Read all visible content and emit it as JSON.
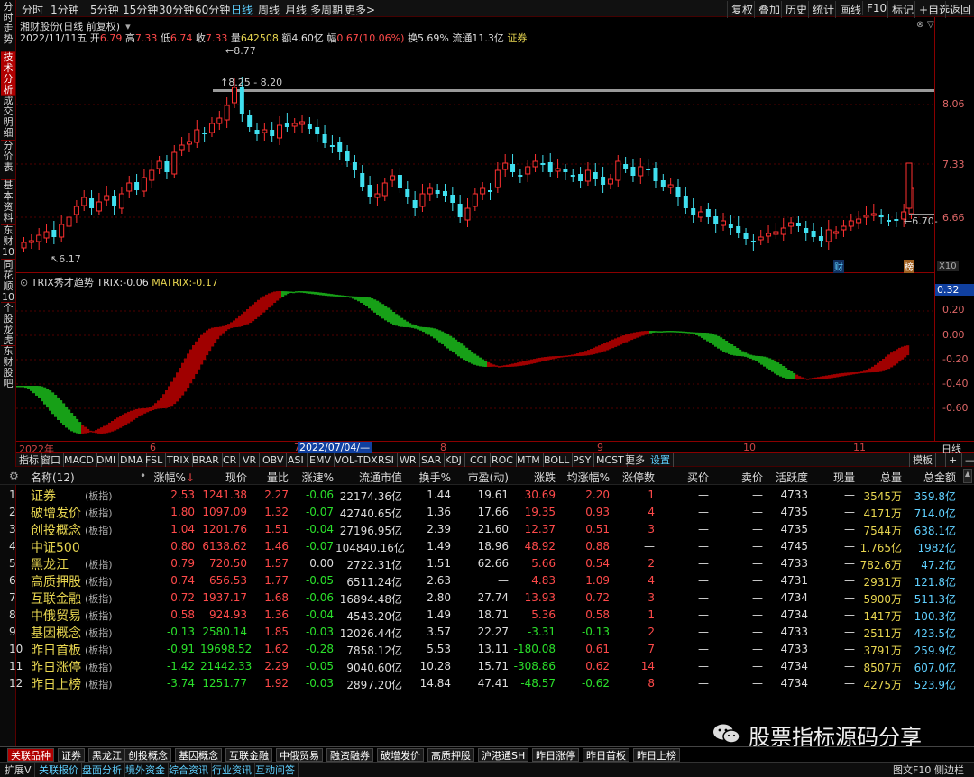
{
  "left_tabs": [
    "分时走势",
    "技术分析",
    "成交明细",
    "分价表",
    "基本资料",
    "东财10",
    "同花顺10",
    "个股龙虎",
    "东财股吧"
  ],
  "toolbar": {
    "periods": [
      "分时",
      "1分钟",
      "5分钟",
      "15分钟",
      "30分钟",
      "60分钟",
      "日线",
      "周线",
      "月线",
      "多周期",
      "更多>"
    ],
    "active_period": "日线",
    "right_buttons": [
      "复权",
      "叠加",
      "历史",
      "统计",
      "画线",
      "F10",
      "标记",
      "+自选",
      "返回"
    ]
  },
  "info": {
    "stock_title": "湘财股份(日线 前复权)",
    "date": "2022/11/11五",
    "open_label": "开",
    "open": "6.79",
    "high_label": "高",
    "high": "7.33",
    "low_label": "低",
    "low": "6.74",
    "close_label": "收",
    "close": "7.33",
    "volume_label": "量",
    "volume": "642508",
    "amount_label": "额",
    "amount": "4.60亿",
    "change_label": "幅",
    "change": "0.67(10.06%)",
    "turnover_label": "换",
    "turnover": "5.69%",
    "float_label": "流通",
    "float": "11.3亿",
    "sector": "证券"
  },
  "main_chart": {
    "price_labels": [
      "8.06",
      "7.33",
      "6.66"
    ],
    "annotations": {
      "high": "8.77",
      "range": "8.25 - 8.20",
      "low": "6.17",
      "last": "6.70"
    },
    "markers": {
      "finance": "财",
      "rank": "榜",
      "zoom": "X10"
    }
  },
  "sub_chart": {
    "title": "TRIX秀才趋势",
    "trix_label": "TRIX:",
    "trix": "-0.06",
    "matrix_label": "MATRIX:",
    "matrix": "-0.17",
    "axis_labels": [
      "0.32",
      "0.20",
      "0.00",
      "-0.20",
      "-0.40",
      "-0.60"
    ]
  },
  "date_axis": {
    "labels": [
      "2022年",
      "6",
      "7",
      "2022/07/04/—",
      "8",
      "9",
      "10",
      "11"
    ],
    "right": "日线"
  },
  "indicator_tabs": [
    "指标",
    "窗口",
    "MACD",
    "DMI",
    "DMA",
    "FSL",
    "TRIX",
    "BRAR",
    "CR",
    "VR",
    "OBV",
    "ASI",
    "EMV",
    "VOL-TDX",
    "RSI",
    "WR",
    "SAR",
    "KDJ",
    "CCI",
    "ROC",
    "MTM",
    "BOLL",
    "PSY",
    "MCST",
    "更多",
    "设置"
  ],
  "indicator_right": [
    "模板",
    "+",
    "—"
  ],
  "table": {
    "headers": [
      "名称(12)",
      "涨幅%",
      "现价",
      "量比",
      "涨速%",
      "流通市值",
      "换手%",
      "市盈(动)",
      "涨跌",
      "均涨幅%",
      "涨停数",
      "买价",
      "卖价",
      "活跃度",
      "现量",
      "总量",
      "总金额"
    ],
    "rows": [
      [
        "1",
        "证券",
        "(板指)",
        "2.53",
        "1241.38",
        "2.27",
        "-0.06",
        "22174.36亿",
        "1.44",
        "19.61",
        "30.69",
        "2.20",
        "1",
        "—",
        "—",
        "4733",
        "—",
        "3545万",
        "359.8亿"
      ],
      [
        "2",
        "破增发价",
        "(板指)",
        "1.80",
        "1097.09",
        "1.32",
        "-0.07",
        "42740.65亿",
        "1.36",
        "17.66",
        "19.35",
        "0.93",
        "4",
        "—",
        "—",
        "4735",
        "—",
        "4171万",
        "714.0亿"
      ],
      [
        "3",
        "创投概念",
        "(板指)",
        "1.04",
        "1201.76",
        "1.51",
        "-0.04",
        "27196.95亿",
        "2.39",
        "21.60",
        "12.37",
        "0.51",
        "3",
        "—",
        "—",
        "4735",
        "—",
        "7544万",
        "638.1亿"
      ],
      [
        "4",
        "中证500",
        "",
        "0.80",
        "6138.62",
        "1.46",
        "-0.07",
        "104840.16亿",
        "1.49",
        "18.96",
        "48.92",
        "0.88",
        "—",
        "—",
        "—",
        "4745",
        "—",
        "1.765亿",
        "1982亿"
      ],
      [
        "5",
        "黑龙江",
        "(板指)",
        "0.79",
        "720.50",
        "1.57",
        "0.00",
        "2722.31亿",
        "1.51",
        "62.66",
        "5.66",
        "0.54",
        "2",
        "—",
        "—",
        "4733",
        "—",
        "782.6万",
        "47.2亿"
      ],
      [
        "6",
        "高质押股",
        "(板指)",
        "0.74",
        "656.53",
        "1.77",
        "-0.05",
        "6511.24亿",
        "2.63",
        "—",
        "4.83",
        "1.09",
        "4",
        "—",
        "—",
        "4731",
        "—",
        "2931万",
        "121.8亿"
      ],
      [
        "7",
        "互联金融",
        "(板指)",
        "0.72",
        "1937.17",
        "1.68",
        "-0.06",
        "16894.48亿",
        "2.80",
        "27.74",
        "13.93",
        "0.72",
        "3",
        "—",
        "—",
        "4734",
        "—",
        "5900万",
        "511.3亿"
      ],
      [
        "8",
        "中俄贸易",
        "(板指)",
        "0.58",
        "924.93",
        "1.36",
        "-0.04",
        "4543.20亿",
        "1.49",
        "18.71",
        "5.36",
        "0.58",
        "1",
        "—",
        "—",
        "4734",
        "—",
        "1417万",
        "100.3亿"
      ],
      [
        "9",
        "基因概念",
        "(板指)",
        "-0.13",
        "2580.14",
        "1.85",
        "-0.03",
        "12026.44亿",
        "3.57",
        "22.27",
        "-3.31",
        "-0.13",
        "2",
        "—",
        "—",
        "4733",
        "—",
        "2511万",
        "423.5亿"
      ],
      [
        "10",
        "昨日首板",
        "(板指)",
        "-0.91",
        "19698.52",
        "1.62",
        "-0.28",
        "7858.12亿",
        "5.53",
        "13.11",
        "-180.08",
        "0.61",
        "7",
        "—",
        "—",
        "4733",
        "—",
        "3791万",
        "259.9亿"
      ],
      [
        "11",
        "昨日涨停",
        "(板指)",
        "-1.42",
        "21442.33",
        "2.29",
        "-0.05",
        "9040.60亿",
        "10.28",
        "15.71",
        "-308.86",
        "0.62",
        "14",
        "—",
        "—",
        "4734",
        "—",
        "8507万",
        "607.0亿"
      ],
      [
        "12",
        "昨日上榜",
        "(板指)",
        "-3.74",
        "1251.77",
        "1.92",
        "-0.03",
        "2897.20亿",
        "14.84",
        "47.41",
        "-48.57",
        "-0.62",
        "8",
        "—",
        "—",
        "4734",
        "—",
        "4275万",
        "523.9亿"
      ]
    ]
  },
  "bottom_tabs": [
    "关联品种",
    "证券",
    "黑龙江",
    "创投概念",
    "基因概念",
    "互联金融",
    "中俄贸易",
    "融资融券",
    "破增发价",
    "高质押股",
    "沪港通SH",
    "昨日涨停",
    "昨日首板",
    "昨日上榜"
  ],
  "status_bar": [
    "扩展V",
    "关联报价",
    "盘面分析",
    "境外资金",
    "综合资讯",
    "行业资讯",
    "互动问答"
  ],
  "status_right": [
    "图文F10",
    "侧边栏≫"
  ],
  "watermark": "股票指标源码分享",
  "colors": {
    "up": "#ff4a4a",
    "down": "#2be02b",
    "accent": "#5fd0ff",
    "grid_red": "#8a0000",
    "trix_red": "#a00000",
    "trix_green": "#17a017"
  }
}
